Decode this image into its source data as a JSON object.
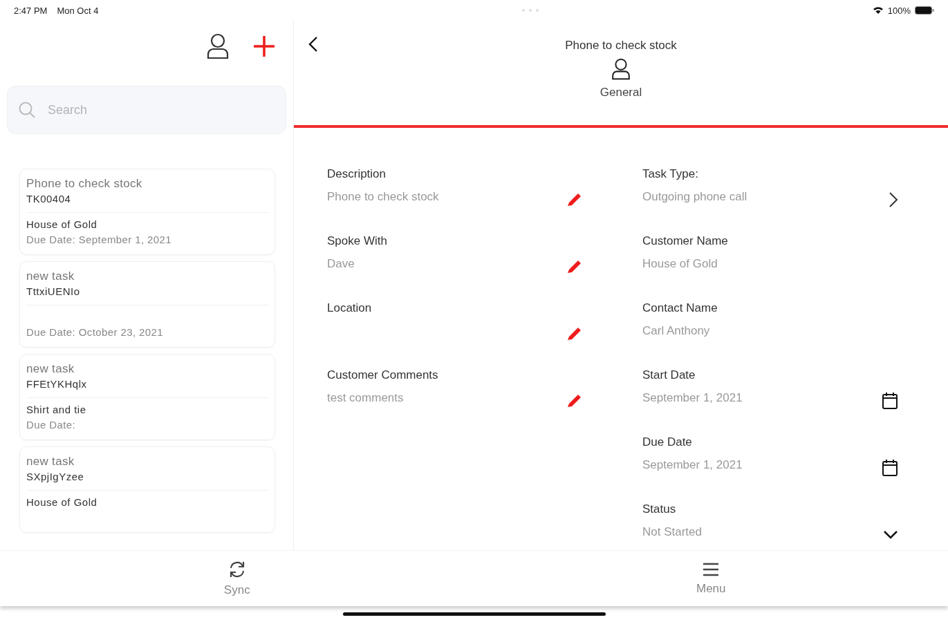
{
  "status_bar": {
    "time": "2:47 PM",
    "date": "Mon Oct 4",
    "battery": "100%"
  },
  "sidebar": {
    "search": {
      "placeholder": "Search"
    },
    "tasks": [
      {
        "title": "Phone to check stock",
        "code": "TK00404",
        "customer": "House of Gold",
        "due": "Due Date: September 1, 2021"
      },
      {
        "title": "new task",
        "code": "TttxiUENIo",
        "due": "Due Date: October 23, 2021"
      },
      {
        "title": "new task",
        "code": "FFEtYKHqlx",
        "customer": "Shirt and tie",
        "due": "Due Date:"
      },
      {
        "title": "new task",
        "code": "SXpjIgYzee",
        "customer": "House of Gold"
      }
    ]
  },
  "detail": {
    "title": "Phone to check stock",
    "tabs": [
      {
        "label": "General",
        "selected": true
      }
    ],
    "left_fields": [
      {
        "label": "Description",
        "value": "Phone to check stock",
        "kind": "edit"
      },
      {
        "label": "Spoke With",
        "value": "Dave",
        "kind": "edit"
      },
      {
        "label": "Location",
        "kind": "edit"
      },
      {
        "label": "Customer Comments",
        "value": "test comments",
        "kind": "edit"
      }
    ],
    "right_fields": [
      {
        "label": "Task Type:",
        "value": "Outgoing phone call",
        "kind": "chevron"
      },
      {
        "label": "Customer Name",
        "value": "House of Gold",
        "kind": "plain"
      },
      {
        "label": "Contact Name",
        "value": "Carl Anthony",
        "kind": "plain"
      },
      {
        "label": "Start Date",
        "value": "September 1, 2021",
        "kind": "calendar"
      },
      {
        "label": "Due Date",
        "value": "September 1, 2021",
        "kind": "calendar"
      },
      {
        "label": "Status",
        "value": "Not Started",
        "kind": "dropdown"
      }
    ]
  },
  "tab_bar": [
    {
      "label": "Sync",
      "kind": "sync"
    },
    {
      "label": "Menu",
      "kind": "menu"
    }
  ]
}
